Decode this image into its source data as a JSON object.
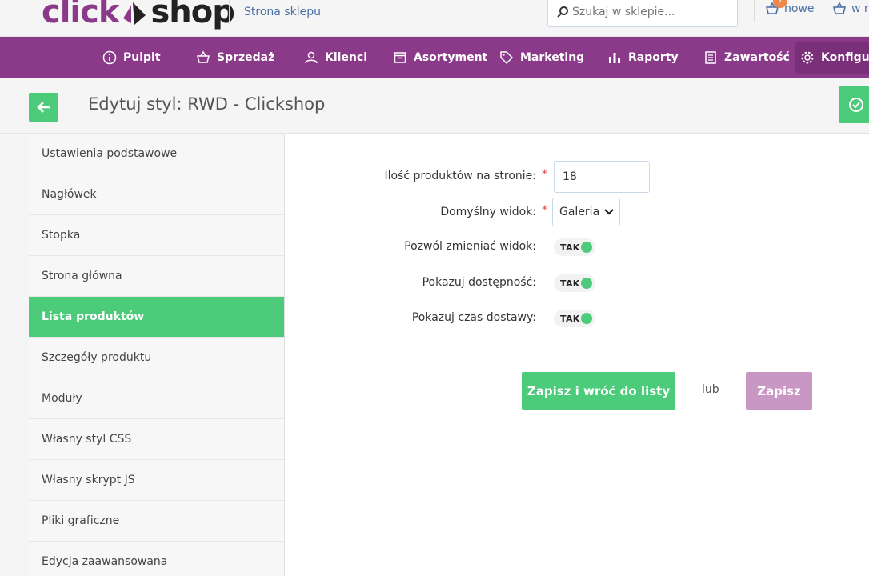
{
  "brand": {
    "logo_left": "click",
    "logo_right": "shop"
  },
  "topbar": {
    "shop_link": "Strona sklepu",
    "search_placeholder": "Szukaj w sklepie...",
    "orders_label": "nowe",
    "orders_badge": "1",
    "cart_label": "w r"
  },
  "nav": {
    "items": [
      {
        "label": "Pulpit",
        "icon": "info-icon"
      },
      {
        "label": "Sprzedaż",
        "icon": "basket-icon"
      },
      {
        "label": "Klienci",
        "icon": "users-icon"
      },
      {
        "label": "Asortyment",
        "icon": "box-icon"
      },
      {
        "label": "Marketing",
        "icon": "tag-icon"
      },
      {
        "label": "Raporty",
        "icon": "bar-chart-icon"
      },
      {
        "label": "Zawartość",
        "icon": "document-icon"
      },
      {
        "label": "Konfigura",
        "icon": "gear-icon"
      }
    ]
  },
  "header": {
    "title": "Edytuj styl: RWD - Clickshop"
  },
  "sidebar": {
    "items": [
      {
        "label": "Ustawienia podstawowe"
      },
      {
        "label": "Nagłówek"
      },
      {
        "label": "Stopka"
      },
      {
        "label": "Strona główna"
      },
      {
        "label": "Lista produktów"
      },
      {
        "label": "Szczegóły produktu"
      },
      {
        "label": "Moduły"
      },
      {
        "label": "Własny styl CSS"
      },
      {
        "label": "Własny skrypt JS"
      },
      {
        "label": "Pliki graficzne"
      },
      {
        "label": "Edycja zaawansowana"
      }
    ],
    "active_index": 4
  },
  "form": {
    "products_per_page": {
      "label": "Ilość produktów na stronie:",
      "value": "18",
      "required": "*"
    },
    "default_view": {
      "label": "Domyślny widok:",
      "value": "Galeria",
      "required": "*"
    },
    "allow_change_view": {
      "label": "Pozwól zmieniać widok:",
      "value": "TAK"
    },
    "show_availability": {
      "label": "Pokazuj dostępność:",
      "value": "TAK"
    },
    "show_delivery_time": {
      "label": "Pokazuj czas dostawy:",
      "value": "TAK"
    }
  },
  "actions": {
    "save_and_return": "Zapisz i wróć do listy",
    "or": "lub",
    "save": "Zapisz"
  },
  "colors": {
    "brand_purple": "#8b3a8a",
    "accent_green": "#4ccb7a",
    "save_disabled": "#c897c4"
  }
}
